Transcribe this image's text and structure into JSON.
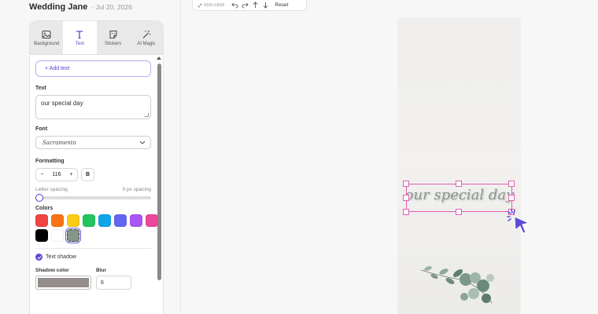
{
  "project": {
    "title": "Wedding Jane",
    "date": "· Jul 20, 2026"
  },
  "tabs": [
    {
      "label": "Background",
      "icon": "image-icon",
      "active": false
    },
    {
      "label": "Text",
      "icon": "text-icon",
      "active": true
    },
    {
      "label": "Stickers",
      "icon": "sticker-icon",
      "active": false
    },
    {
      "label": "AI Magic",
      "icon": "magic-wand-icon",
      "active": false
    }
  ],
  "panel": {
    "add_text_label": "+ Add text",
    "text_label": "Text",
    "text_value": "our special day",
    "font_label": "Font",
    "font_value": "Sacramento",
    "formatting_label": "Formatting",
    "font_size": "116",
    "minus": "−",
    "plus": "+",
    "bold_label": "B",
    "letter_spacing_label": "Letter spacing",
    "letter_spacing_value": "0 px spacing",
    "colors_label": "Colors",
    "text_shadow_label": "Text shadow",
    "shadow_color_label": "Shadow color",
    "blur_label": "Blur",
    "blur_value": "6"
  },
  "colors": [
    "#ef4444",
    "#f97316",
    "#facc15",
    "#22c55e",
    "#0ea5e9",
    "#6366f1",
    "#a855f7",
    "#ec4899",
    "#000000",
    "#ffffff",
    "#86958a"
  ],
  "selected_color": "#86958a",
  "shadow_color": "#958c8c",
  "toolbar": {
    "dims": "600×1800",
    "reset_label": "Reset"
  },
  "canvas": {
    "text": "our special day",
    "text_color": "#86958a",
    "selection_color": "#e05fb4"
  }
}
